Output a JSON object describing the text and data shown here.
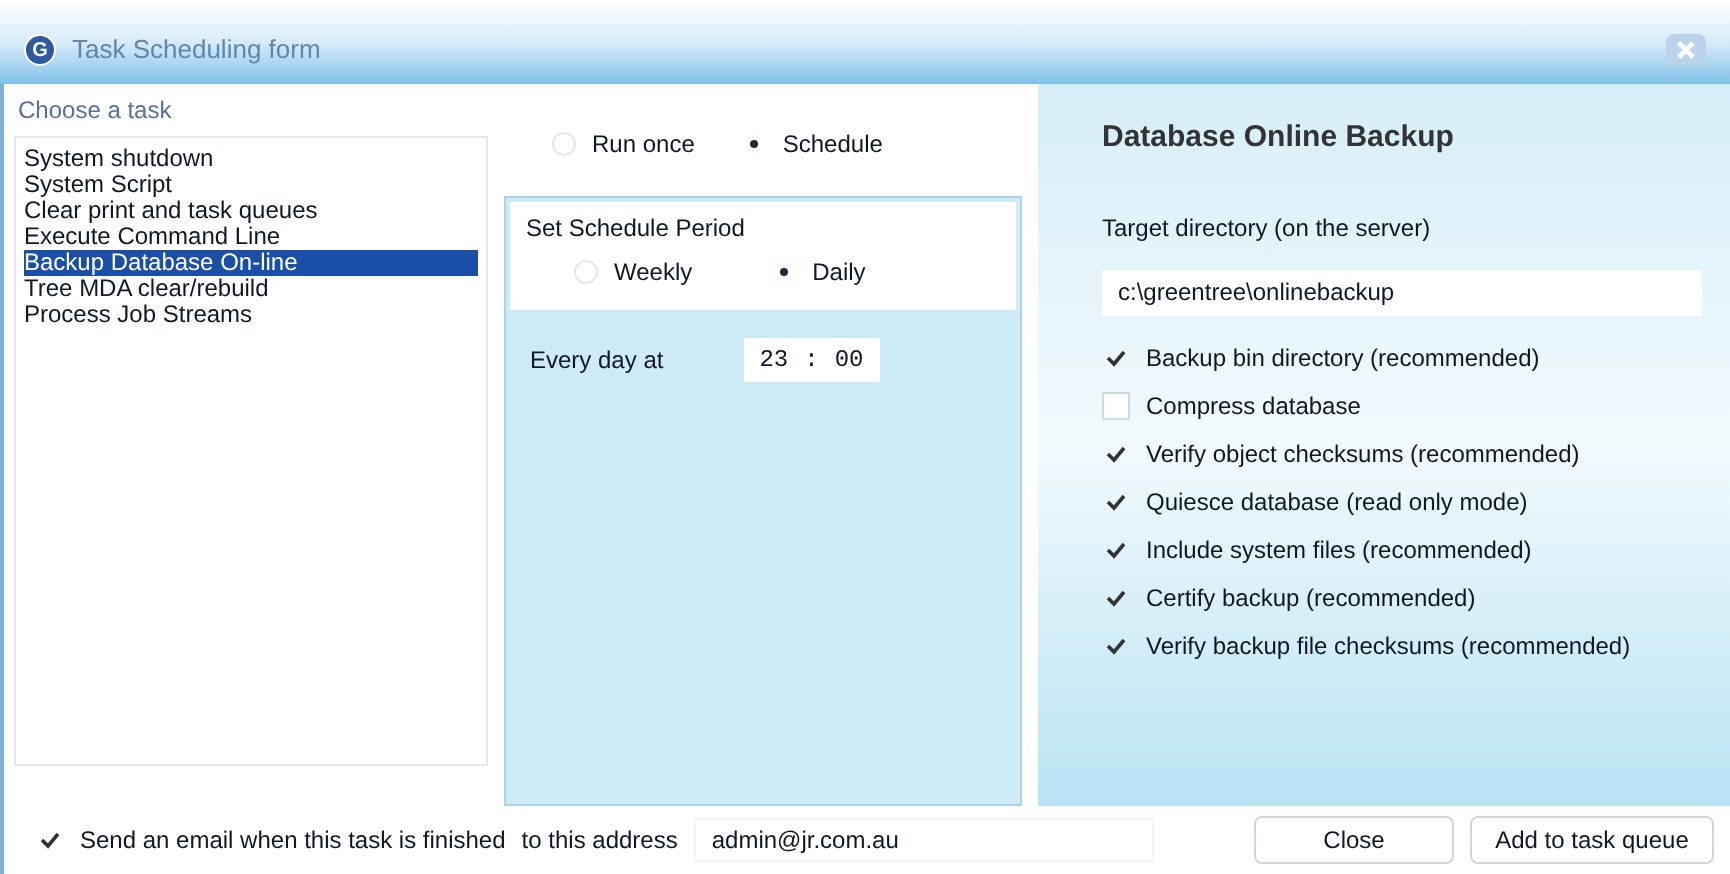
{
  "window": {
    "title": "Task Scheduling form",
    "icon_letter": "G"
  },
  "task_list": {
    "label": "Choose a task",
    "items": [
      {
        "label": "System shutdown",
        "selected": false
      },
      {
        "label": "System Script",
        "selected": false
      },
      {
        "label": "Clear print and task queues",
        "selected": false
      },
      {
        "label": "Execute Command Line",
        "selected": false
      },
      {
        "label": "Backup Database On-line",
        "selected": true
      },
      {
        "label": "Tree MDA clear/rebuild",
        "selected": false
      },
      {
        "label": "Process Job Streams",
        "selected": false
      }
    ]
  },
  "run_mode": [
    {
      "label": "Run once",
      "selected": false
    },
    {
      "label": "Schedule",
      "selected": true
    }
  ],
  "schedule_period": {
    "title": "Set Schedule Period",
    "options": [
      {
        "label": "Weekly",
        "selected": false
      },
      {
        "label": "Daily",
        "selected": true
      }
    ]
  },
  "time": {
    "label": "Every day at",
    "hours": "23",
    "separator": ":",
    "minutes": "00"
  },
  "backup": {
    "title": "Database Online Backup",
    "directory_label": "Target directory (on the server)",
    "directory": "c:\\greentree\\onlinebackup",
    "options": [
      {
        "label": "Backup bin directory (recommended)",
        "checked": true
      },
      {
        "label": "Compress database",
        "checked": false
      },
      {
        "label": "Verify object checksums (recommended)",
        "checked": true
      },
      {
        "label": "Quiesce database (read only mode)",
        "checked": true
      },
      {
        "label": "Include system files (recommended)",
        "checked": true
      },
      {
        "label": "Certify backup (recommended)",
        "checked": true
      },
      {
        "label": "Verify backup file checksums (recommended)",
        "checked": true
      }
    ]
  },
  "email": {
    "checked": true,
    "label": "Send an email when this task is finished",
    "address_label": "to this address",
    "address": "admin@jr.com.au"
  },
  "buttons": [
    "Close",
    "Add to task queue"
  ]
}
